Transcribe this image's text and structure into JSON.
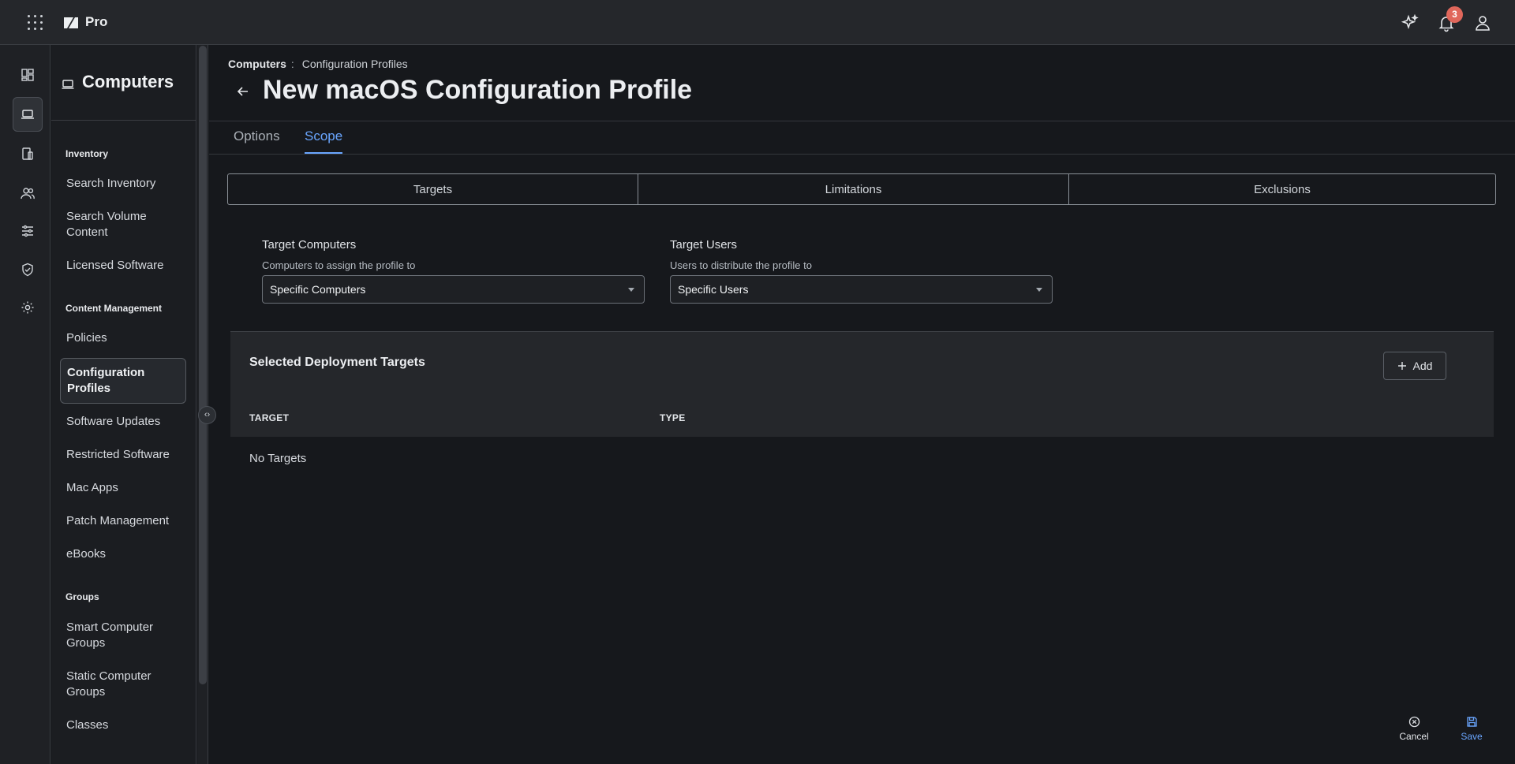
{
  "app": {
    "brand": "Pro",
    "notification_count": "3"
  },
  "topbar": {
    "icons": [
      "apps-grid-icon",
      "sparkle-ai-icon",
      "bell-icon",
      "user-icon"
    ]
  },
  "rail": {
    "items": [
      "dashboard-icon",
      "computer-icon",
      "devices-icon",
      "users-icon",
      "sliders-icon",
      "shield-check-icon",
      "gear-icon"
    ],
    "active": "computer-icon"
  },
  "sidebar": {
    "title": "Computers",
    "sections": {
      "inventory": "Inventory",
      "content_management": "Content Management",
      "groups": "Groups"
    },
    "items": {
      "search_inventory": "Search Inventory",
      "search_volume_content": "Search Volume Content",
      "licensed_software": "Licensed Software",
      "policies": "Policies",
      "configuration_profiles": "Configuration Profiles",
      "software_updates": "Software Updates",
      "restricted_software": "Restricted Software",
      "mac_apps": "Mac Apps",
      "patch_management": "Patch Management",
      "ebooks": "eBooks",
      "smart_computer_groups": "Smart Computer Groups",
      "static_computer_groups": "Static Computer Groups",
      "classes": "Classes"
    },
    "active": "Configuration Profiles"
  },
  "breadcrumb": {
    "parent": "Computers",
    "separator": ":",
    "current": "Configuration Profiles"
  },
  "page": {
    "title": "New macOS Configuration Profile"
  },
  "tabs": {
    "options": "Options",
    "scope": "Scope",
    "active": "Scope"
  },
  "scope_segments": {
    "targets": "Targets",
    "limitations": "Limitations",
    "exclusions": "Exclusions"
  },
  "target_computers": {
    "label": "Target Computers",
    "help": "Computers to assign the profile to",
    "value": "Specific Computers"
  },
  "target_users": {
    "label": "Target Users",
    "help": "Users to distribute the profile to",
    "value": "Specific Users"
  },
  "deployment": {
    "title": "Selected Deployment Targets",
    "add_label": "Add",
    "columns": {
      "target": "TARGET",
      "type": "TYPE"
    },
    "empty_text": "No Targets"
  },
  "footer": {
    "cancel": "Cancel",
    "save": "Save"
  },
  "colors": {
    "accent": "#6aa6ff",
    "badge": "#e0675b",
    "background": "#16181c"
  }
}
